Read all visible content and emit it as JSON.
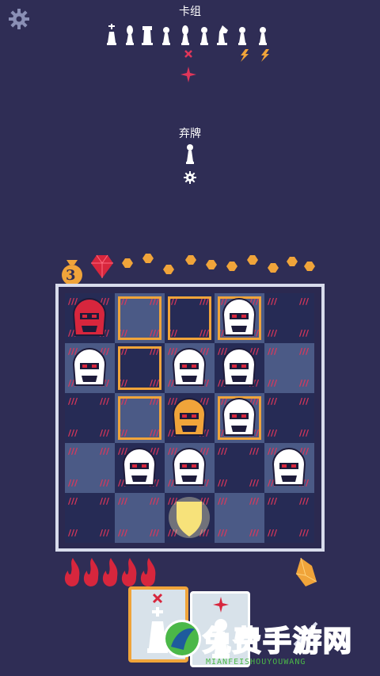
{
  "header": {
    "deck_title": "卡组",
    "discard_title": "弃牌"
  },
  "icons": {
    "settings": "gear-icon",
    "deck_pieces": [
      "king",
      "bishop",
      "rook",
      "pawn",
      "bishop",
      "pawn",
      "knight",
      "pawn",
      "pawn"
    ],
    "deck_badges": [
      "cross-red",
      "star-red",
      "lightning-yellow",
      "lightning-yellow"
    ],
    "discard_pieces": [
      "pawn"
    ],
    "discard_badge": "gear-white"
  },
  "hud": {
    "bag_count": "3",
    "coins": 10,
    "gem": "red-gem",
    "flames": 5,
    "crystal": "orange-crystal"
  },
  "board": {
    "rows": 5,
    "cols": 5,
    "pieces": [
      {
        "name": "red-helmet-enemy",
        "row": 0,
        "col": 0,
        "color": "#d7263d"
      },
      {
        "name": "masked-knight-enemy",
        "row": 0,
        "col": 3,
        "color": "#ffffff"
      },
      {
        "name": "goblin-enemy",
        "row": 1,
        "col": 0,
        "color": "#ffffff"
      },
      {
        "name": "horned-knight-enemy",
        "row": 1,
        "col": 2,
        "color": "#ffffff"
      },
      {
        "name": "boar-mask-enemy",
        "row": 1,
        "col": 3,
        "color": "#ffffff"
      },
      {
        "name": "golden-demon-enemy",
        "row": 2,
        "col": 2,
        "color": "#f0a43a"
      },
      {
        "name": "furry-beast-enemy",
        "row": 2,
        "col": 3,
        "color": "#ffffff"
      },
      {
        "name": "armored-knight-enemy",
        "row": 3,
        "col": 1,
        "color": "#ffffff"
      },
      {
        "name": "visored-knight-enemy",
        "row": 3,
        "col": 2,
        "color": "#ffffff"
      },
      {
        "name": "yeti-enemy",
        "row": 3,
        "col": 4,
        "color": "#ffffff"
      },
      {
        "name": "shield-player",
        "row": 4,
        "col": 2,
        "color": "#f7e27a"
      }
    ],
    "selected": [
      [
        0,
        1
      ],
      [
        0,
        2
      ],
      [
        0,
        3
      ],
      [
        1,
        1
      ],
      [
        2,
        1
      ],
      [
        2,
        3
      ]
    ]
  },
  "hand": [
    {
      "piece": "king",
      "badge": "cross-red",
      "selected": true
    },
    {
      "piece": "pawn",
      "badge": "star-red",
      "selected": false
    }
  ],
  "watermark": {
    "title": "免费手游网",
    "subtitle": "MIANFEISHOUYOUWANG"
  }
}
